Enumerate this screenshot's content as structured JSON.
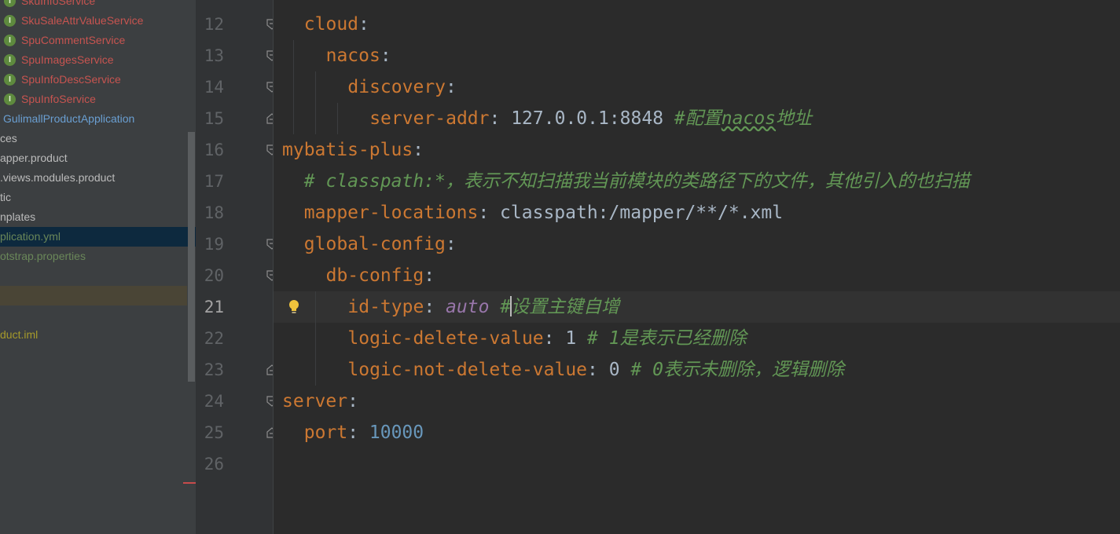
{
  "project_tree": {
    "items": [
      {
        "label": "SkuInfoService",
        "type": "interface",
        "color": "#c75450"
      },
      {
        "label": "SkuSaleAttrValueService",
        "type": "interface",
        "color": "#c75450"
      },
      {
        "label": "SpuCommentService",
        "type": "interface",
        "color": "#c75450"
      },
      {
        "label": "SpuImagesService",
        "type": "interface",
        "color": "#c75450"
      },
      {
        "label": "SpuInfoDescService",
        "type": "interface",
        "color": "#c75450"
      },
      {
        "label": "SpuInfoService",
        "type": "interface",
        "color": "#c75450"
      },
      {
        "label": "GulimallProductApplication",
        "type": "class",
        "color": "#6a9fd2"
      },
      {
        "label": "ces",
        "type": "folder",
        "color": "#bbbbbb"
      },
      {
        "label": "apper.product",
        "type": "folder",
        "color": "#bbbbbb"
      },
      {
        "label": ".views.modules.product",
        "type": "folder",
        "color": "#bbbbbb"
      },
      {
        "label": "tic",
        "type": "folder",
        "color": "#bbbbbb"
      },
      {
        "label": "nplates",
        "type": "folder",
        "color": "#bbbbbb"
      },
      {
        "label": "plication.yml",
        "type": "file",
        "color": "#6a8759",
        "selected": true
      },
      {
        "label": "otstrap.properties",
        "type": "file",
        "color": "#6a8759"
      },
      {
        "label": "",
        "type": "blank",
        "color": "#bbbbbb"
      },
      {
        "label": "",
        "type": "blank",
        "color": "#bbbbbb",
        "highlighted": true
      },
      {
        "label": "",
        "type": "blank",
        "color": "#bbbbbb"
      },
      {
        "label": "duct.iml",
        "type": "file",
        "color": "#a59a2b"
      }
    ]
  },
  "badge_letter": "I",
  "editor": {
    "current_line": "21",
    "lines": [
      {
        "num": "12",
        "indent": 1,
        "fold": "open",
        "tokens": [
          {
            "t": "cloud",
            "c": "key"
          },
          {
            "t": ":",
            "c": "val"
          }
        ]
      },
      {
        "num": "13",
        "indent": 2,
        "fold": "open",
        "tokens": [
          {
            "t": "nacos",
            "c": "key"
          },
          {
            "t": ":",
            "c": "val"
          }
        ]
      },
      {
        "num": "14",
        "indent": 3,
        "fold": "open",
        "tokens": [
          {
            "t": "discovery",
            "c": "key"
          },
          {
            "t": ":",
            "c": "val"
          }
        ]
      },
      {
        "num": "15",
        "indent": 4,
        "fold": "end",
        "tokens": [
          {
            "t": "server-addr",
            "c": "key"
          },
          {
            "t": ": 127.0.0.1:8848 ",
            "c": "val"
          },
          {
            "t": "#配置",
            "c": "cmt"
          },
          {
            "t": "nacos",
            "c": "cmt squiggle"
          },
          {
            "t": "地址",
            "c": "cmt"
          }
        ]
      },
      {
        "num": "16",
        "indent": 0,
        "fold": "open",
        "tokens": [
          {
            "t": "mybatis-plus",
            "c": "key"
          },
          {
            "t": ":",
            "c": "val"
          }
        ]
      },
      {
        "num": "17",
        "indent": 1,
        "fold": "",
        "tokens": [
          {
            "t": "# classpath:*，表示不知扫描我当前模块的类路径下的文件，其他引入的也扫描",
            "c": "cmt"
          }
        ]
      },
      {
        "num": "18",
        "indent": 1,
        "fold": "",
        "tokens": [
          {
            "t": "mapper-locations",
            "c": "key"
          },
          {
            "t": ": classpath:/mapper/**/*.xml",
            "c": "val"
          }
        ]
      },
      {
        "num": "19",
        "indent": 1,
        "fold": "open",
        "tokens": [
          {
            "t": "global-config",
            "c": "key"
          },
          {
            "t": ":",
            "c": "val"
          }
        ]
      },
      {
        "num": "20",
        "indent": 2,
        "fold": "open",
        "tokens": [
          {
            "t": "db-config",
            "c": "key"
          },
          {
            "t": ":",
            "c": "val"
          }
        ]
      },
      {
        "num": "21",
        "indent": 3,
        "fold": "",
        "tokens": [
          {
            "t": "id-type",
            "c": "key"
          },
          {
            "t": ": ",
            "c": "val"
          },
          {
            "t": "auto",
            "c": "kw"
          },
          {
            "t": " #",
            "c": "cmt"
          },
          {
            "t": "|",
            "c": "caret"
          },
          {
            "t": "设置主键自增",
            "c": "cmt"
          }
        ]
      },
      {
        "num": "22",
        "indent": 3,
        "fold": "",
        "tokens": [
          {
            "t": "logic-delete-value",
            "c": "key"
          },
          {
            "t": ": 1 ",
            "c": "val"
          },
          {
            "t": "# 1是表示已经删除",
            "c": "cmt"
          }
        ]
      },
      {
        "num": "23",
        "indent": 3,
        "fold": "end",
        "tokens": [
          {
            "t": "logic-not-delete-value",
            "c": "key"
          },
          {
            "t": ": 0 ",
            "c": "val"
          },
          {
            "t": "# 0表示未删除，逻辑删除",
            "c": "cmt"
          }
        ]
      },
      {
        "num": "24",
        "indent": 0,
        "fold": "open",
        "tokens": [
          {
            "t": "server",
            "c": "key"
          },
          {
            "t": ":",
            "c": "val"
          }
        ]
      },
      {
        "num": "25",
        "indent": 1,
        "fold": "end",
        "tokens": [
          {
            "t": "port",
            "c": "key"
          },
          {
            "t": ": ",
            "c": "val"
          },
          {
            "t": "10000",
            "c": "num"
          }
        ]
      },
      {
        "num": "26",
        "indent": 0,
        "fold": "",
        "tokens": []
      }
    ]
  },
  "icons": {
    "interface_badge": "interface-icon",
    "intention": "lightbulb-icon",
    "fold_open": "fold-open-icon",
    "fold_end": "fold-end-icon"
  },
  "colors": {
    "editor_bg": "#2b2b2b",
    "sidebar_bg": "#3c3f41",
    "key": "#cc7832",
    "comment": "#629755",
    "number": "#6897bb",
    "constant": "#9876aa",
    "selection": "#0d293e"
  }
}
